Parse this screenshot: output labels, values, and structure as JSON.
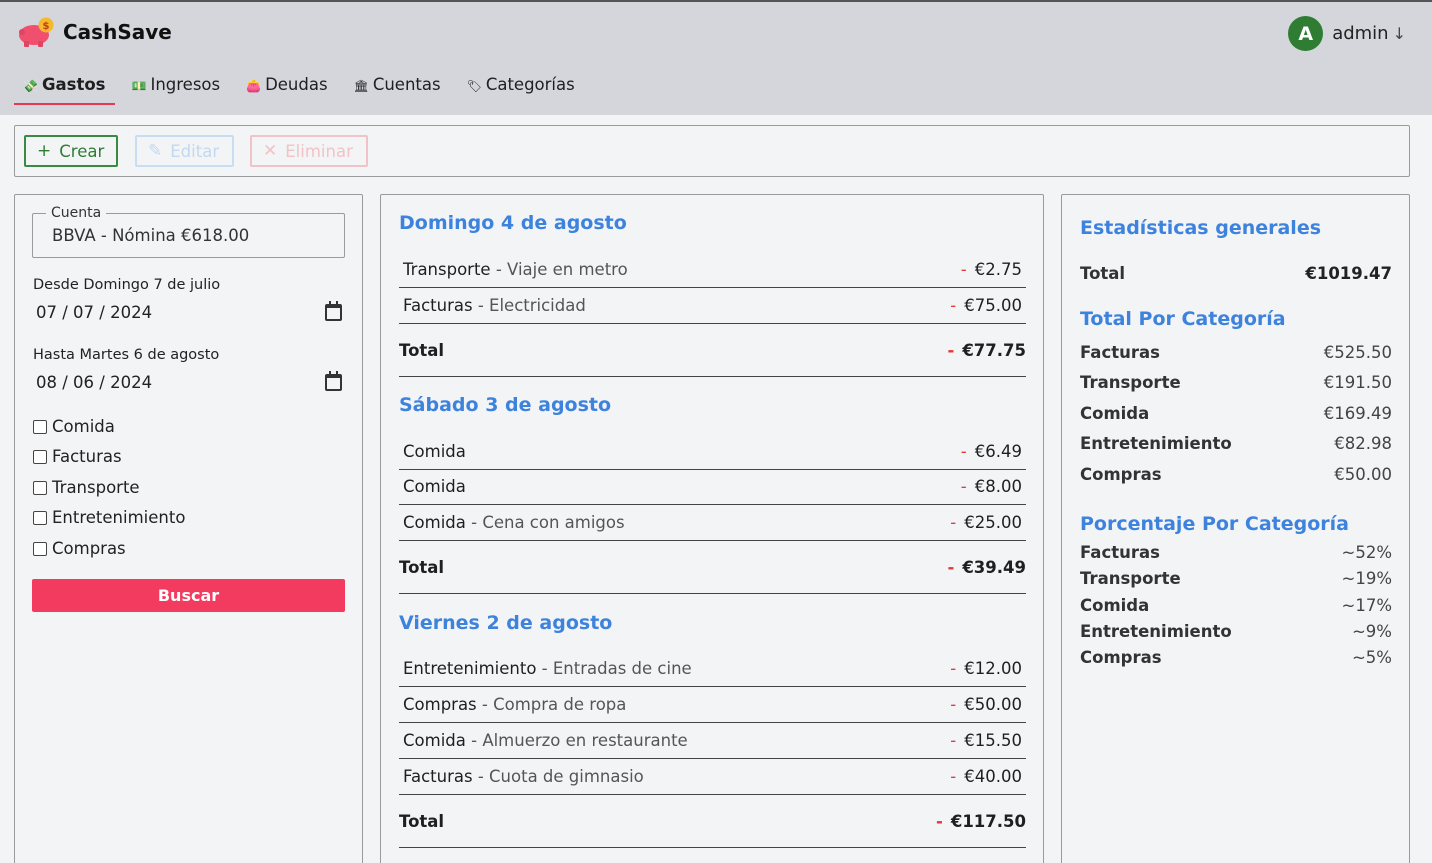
{
  "app": {
    "name": "CashSave"
  },
  "user": {
    "initial": "A",
    "name": "admin",
    "arrow": "↓"
  },
  "tabs": [
    {
      "label": "Gastos",
      "icon": "💸"
    },
    {
      "label": "Ingresos",
      "icon": "💵"
    },
    {
      "label": "Deudas",
      "icon": "👛"
    },
    {
      "label": "Cuentas",
      "icon": "🏛"
    },
    {
      "label": "Categorías",
      "icon": "🏷"
    }
  ],
  "toolbar": {
    "create": "Crear",
    "edit": "Editar",
    "delete": "Eliminar"
  },
  "filters": {
    "account_legend": "Cuenta",
    "account_value": "BBVA - Nómina €618.00",
    "from_label": "Desde Domingo 7 de julio",
    "from_value": "07 / 07 / 2024",
    "to_label": "Hasta Martes 6 de agosto",
    "to_value": "08 / 06 / 2024",
    "categories": [
      "Comida",
      "Facturas",
      "Transporte",
      "Entretenimiento",
      "Compras"
    ],
    "search_button": "Buscar"
  },
  "days": [
    {
      "title": "Domingo 4 de agosto",
      "items": [
        {
          "category": "Transporte",
          "description": "Viaje en metro",
          "amount": "€2.75"
        },
        {
          "category": "Facturas",
          "description": "Electricidad",
          "amount": "€75.00"
        }
      ],
      "total_label": "Total",
      "total": "€77.75"
    },
    {
      "title": "Sábado 3 de agosto",
      "items": [
        {
          "category": "Comida",
          "description": "",
          "amount": "€6.49"
        },
        {
          "category": "Comida",
          "description": "",
          "amount": "€8.00"
        },
        {
          "category": "Comida",
          "description": "Cena con amigos",
          "amount": "€25.00"
        }
      ],
      "total_label": "Total",
      "total": "€39.49"
    },
    {
      "title": "Viernes 2 de agosto",
      "items": [
        {
          "category": "Entretenimiento",
          "description": "Entradas de cine",
          "amount": "€12.00"
        },
        {
          "category": "Compras",
          "description": "Compra de ropa",
          "amount": "€50.00"
        },
        {
          "category": "Comida",
          "description": "Almuerzo en restaurante",
          "amount": "€15.50"
        },
        {
          "category": "Facturas",
          "description": "Cuota de gimnasio",
          "amount": "€40.00"
        }
      ],
      "total_label": "Total",
      "total": "€117.50"
    }
  ],
  "stats": {
    "general_title": "Estadísticas generales",
    "total_label": "Total",
    "total_value": "€1019.47",
    "by_category_title": "Total Por Categoría",
    "by_category": [
      {
        "k": "Facturas",
        "v": "€525.50"
      },
      {
        "k": "Transporte",
        "v": "€191.50"
      },
      {
        "k": "Comida",
        "v": "€169.49"
      },
      {
        "k": "Entretenimiento",
        "v": "€82.98"
      },
      {
        "k": "Compras",
        "v": "€50.00"
      }
    ],
    "percent_title": "Porcentaje Por Categoría",
    "percent": [
      {
        "k": "Facturas",
        "v": "~52%"
      },
      {
        "k": "Transporte",
        "v": "~19%"
      },
      {
        "k": "Comida",
        "v": "~17%"
      },
      {
        "k": "Entretenimiento",
        "v": "~9%"
      },
      {
        "k": "Compras",
        "v": "~5%"
      }
    ]
  },
  "colors": {
    "accent": "#3d83dd",
    "danger": "#f23b5e",
    "success": "#2e7d32"
  }
}
